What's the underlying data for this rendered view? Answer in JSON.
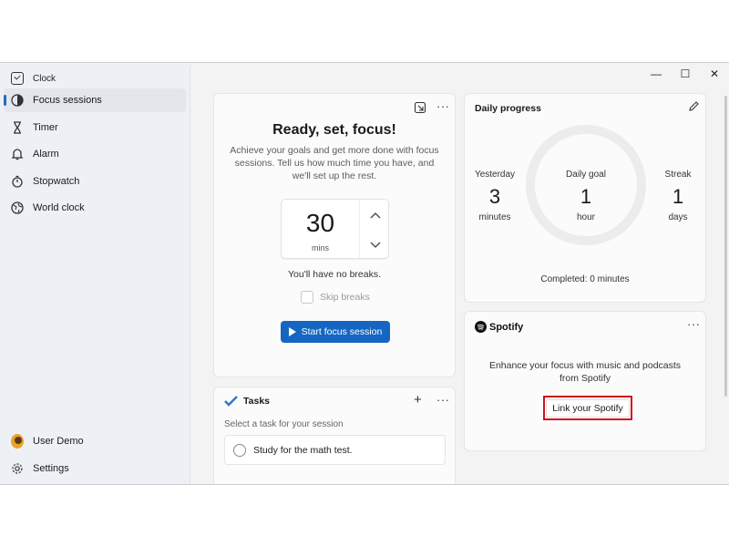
{
  "app": {
    "title": "Clock"
  },
  "window_controls": {
    "minimize": "—",
    "maximize": "☐",
    "close": "✕"
  },
  "sidebar": {
    "items": [
      {
        "label": "Focus sessions",
        "icon": "focus-icon",
        "active": true
      },
      {
        "label": "Timer",
        "icon": "hourglass-icon"
      },
      {
        "label": "Alarm",
        "icon": "bell-icon"
      },
      {
        "label": "Stopwatch",
        "icon": "stopwatch-icon"
      },
      {
        "label": "World clock",
        "icon": "globe-icon"
      }
    ],
    "user": {
      "label": "User Demo"
    },
    "settings": {
      "label": "Settings"
    }
  },
  "focus": {
    "title": "Ready, set, focus!",
    "description": "Achieve your goals and get more done with focus sessions. Tell us how much time you have, and we'll set up the rest.",
    "minutes": "30",
    "unit": "mins",
    "breaks_text": "You'll have no breaks.",
    "skip_breaks_label": "Skip breaks",
    "start_button": "Start focus session",
    "more": "···"
  },
  "daily_progress": {
    "title": "Daily progress",
    "yesterday": {
      "label": "Yesterday",
      "value": "3",
      "unit": "minutes"
    },
    "goal": {
      "label": "Daily goal",
      "value": "1",
      "unit": "hour"
    },
    "streak": {
      "label": "Streak",
      "value": "1",
      "unit": "days"
    },
    "completed": "Completed: 0 minutes",
    "progress_fraction": 0
  },
  "tasks": {
    "title": "Tasks",
    "hint": "Select a task for your session",
    "items": [
      {
        "label": "Study for the math test."
      }
    ],
    "add": "+",
    "more": "···"
  },
  "spotify": {
    "brand": "Spotify",
    "description": "Enhance your focus with music and podcasts from Spotify",
    "link_button": "Link your Spotify",
    "more": "···"
  },
  "colors": {
    "accent": "#1566c2",
    "highlight": "#d0121b",
    "sidebar_bg": "#edf1f6"
  }
}
